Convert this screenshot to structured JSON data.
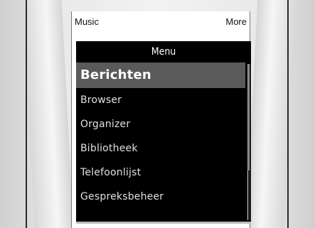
{
  "softkeys": {
    "left_label": "Music",
    "right_label": "More"
  },
  "menu": {
    "title": "Menu",
    "items": [
      {
        "label": "Berichten",
        "selected": true
      },
      {
        "label": "Browser",
        "selected": false
      },
      {
        "label": "Organizer",
        "selected": false
      },
      {
        "label": "Bibliotheek",
        "selected": false
      },
      {
        "label": "Telefoonlijst",
        "selected": false
      },
      {
        "label": "Gespreksbeheer",
        "selected": false
      }
    ]
  },
  "colors": {
    "menu_background": "#000000",
    "selected_highlight": "#5a5a5a",
    "menu_text": "#e0e0e0"
  }
}
